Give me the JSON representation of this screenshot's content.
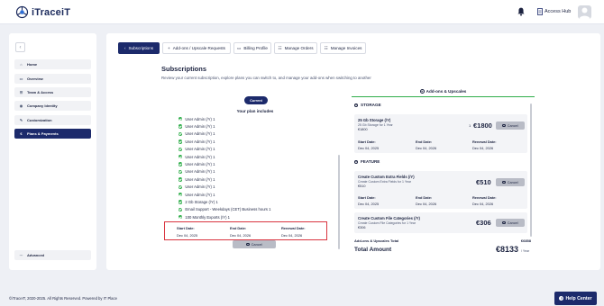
{
  "header": {
    "logo_text": "iTraceiT",
    "access_hub_label": "Access Hub"
  },
  "sidebar": {
    "collapse_icon": "chevron-left-icon",
    "items": [
      {
        "label": "Home",
        "icon": "home-icon"
      },
      {
        "label": "Overview",
        "icon": "overview-icon"
      },
      {
        "label": "Team & Access",
        "icon": "team-icon"
      },
      {
        "label": "Company Identity",
        "icon": "company-icon"
      },
      {
        "label": "Customization",
        "icon": "customization-icon"
      },
      {
        "label": "Plans & Payments",
        "icon": "payments-icon",
        "active": true
      }
    ],
    "advanced_label": "Advanced"
  },
  "tabs": [
    {
      "label": "Subscriptions",
      "active": true
    },
    {
      "label": "Add-ons / Upscale Requests"
    },
    {
      "label": "Billing Profile"
    },
    {
      "label": "Manage Orders"
    },
    {
      "label": "Manage Invoices"
    }
  ],
  "main": {
    "title": "Subscriptions",
    "subtitle": "Review your current subscription, explore plans you can switch to, and manage your add-ons when switching to another"
  },
  "plan": {
    "badge": "Current",
    "includes_title": "Your plan includes",
    "features": [
      "User Admin (/Y) 1",
      "User Admin (/Y) 1",
      "User Admin (/Y) 1",
      "User Admin (/Y) 1",
      "User Admin (/Y) 1",
      "User Admin (/Y) 1",
      "User Admin (/Y) 1",
      "User Admin (/Y) 1",
      "User Admin (/Y) 1",
      "User Admin (/Y) 1",
      "User Admin (/Y) 1",
      "2 Gb Storage (/Y) 1",
      "Email Support - Weekdays (CET) Business hours 1",
      "100 Monthly Exports (/Y) 1"
    ],
    "start_label": "Start Date:",
    "start_value": "Dec 04, 2025",
    "end_label": "End Date:",
    "end_value": "Dec 04, 2026",
    "renewal_label": "Renewal Date:",
    "renewal_value": "Dec 04, 2026",
    "cancel_label": "Cancel"
  },
  "addons": {
    "header": "Add-ons & Upscales",
    "storage_title": "STORAGE",
    "feature_title": "FEATURE",
    "storage_card": {
      "name": "25 Gb Storage (/Y)",
      "sub": "25 Gb Storage for 1 Year",
      "price_per": "€1800",
      "qty": "1",
      "price": "€1800",
      "cancel": "Cancel",
      "start_label": "Start Date:",
      "start_value": "Dec 04, 2025",
      "end_label": "End Date:",
      "end_value": "Dec 04, 2026",
      "renewal_label": "Renewal Date:",
      "renewal_value": "Dec 04, 2026"
    },
    "feature_cards": [
      {
        "name": "Create Custom Extra Fields (/Y)",
        "sub": "Create Custom Extra Fields for 1 Year",
        "price_per": "€510",
        "price": "€510",
        "cancel": "Cancel",
        "start_label": "Start Date:",
        "start_value": "Dec 04, 2025",
        "end_label": "End Date:",
        "end_value": "Dec 04, 2026",
        "renewal_label": "Renewal Date:",
        "renewal_value": "Dec 04, 2026"
      },
      {
        "name": "Create Custom File Categories (/Y)",
        "sub": "Create Custom File Categories for 1 Year",
        "price_per": "€306",
        "price": "€306",
        "cancel": "Cancel"
      }
    ],
    "total_label": "Add-ons & Upscales Total",
    "total_value": "€6858",
    "total_amount_label": "Total Amount",
    "total_amount_value": "€8133",
    "per_year": "/ Year"
  },
  "footer": {
    "copyright": "©iTraceIT, 2020-2025. All Rights Reserved. Powered by IT Place",
    "help_label": "Help Center"
  },
  "colors": {
    "brand_navy": "#1c2a6b",
    "success_green": "#2fae4a",
    "highlight_red": "#d9343f"
  }
}
